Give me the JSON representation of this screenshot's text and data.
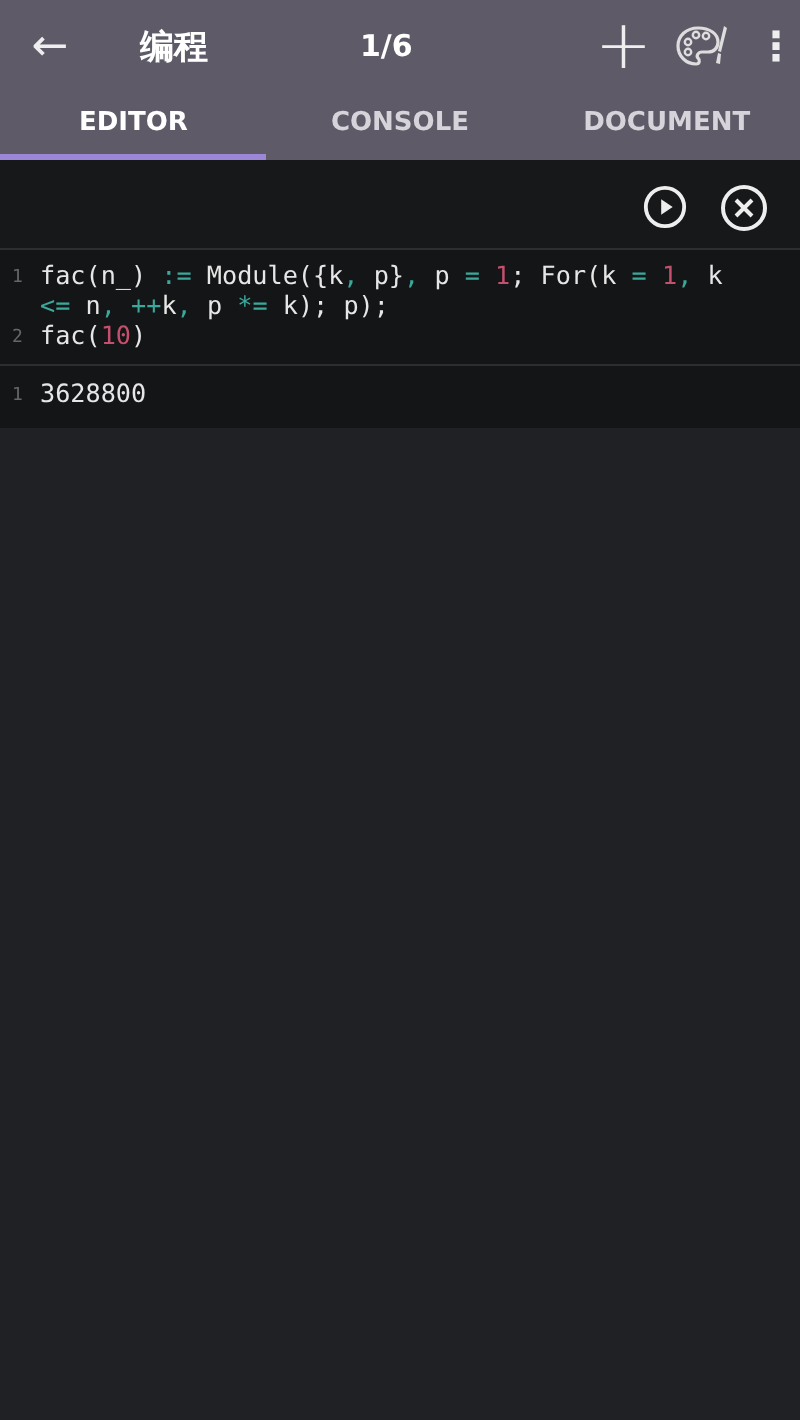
{
  "app_bar": {
    "back": "←",
    "title": "编程",
    "page": "1/6",
    "add": "+",
    "menu": "⋮"
  },
  "tabs": [
    {
      "label": "EDITOR",
      "selected": true
    },
    {
      "label": "CONSOLE",
      "selected": false
    },
    {
      "label": "DOCUMENT",
      "selected": false
    }
  ],
  "input_cell": {
    "lines": [
      {
        "number": "1",
        "tokens": [
          {
            "kind": "plain",
            "text": "fac(n_) "
          },
          {
            "kind": "op",
            "text": ":="
          },
          {
            "kind": "plain",
            "text": " Module({k"
          },
          {
            "kind": "op",
            "text": ","
          },
          {
            "kind": "plain",
            "text": " p}"
          },
          {
            "kind": "op",
            "text": ","
          },
          {
            "kind": "plain",
            "text": " p "
          },
          {
            "kind": "op",
            "text": "="
          },
          {
            "kind": "num",
            "text": " 1"
          },
          {
            "kind": "plain",
            "text": "; For(k "
          },
          {
            "kind": "op",
            "text": "="
          },
          {
            "kind": "num",
            "text": " 1"
          },
          {
            "kind": "op",
            "text": ","
          },
          {
            "kind": "plain",
            "text": " k "
          },
          {
            "kind": "op",
            "text": "<="
          },
          {
            "kind": "plain",
            "text": " n"
          },
          {
            "kind": "op",
            "text": ", ++"
          },
          {
            "kind": "plain",
            "text": "k"
          },
          {
            "kind": "op",
            "text": ","
          },
          {
            "kind": "plain",
            "text": " p "
          },
          {
            "kind": "op",
            "text": "*="
          },
          {
            "kind": "plain",
            "text": " k); p);"
          }
        ]
      },
      {
        "number": "2",
        "tokens": [
          {
            "kind": "plain",
            "text": "fac("
          },
          {
            "kind": "num",
            "text": "10"
          },
          {
            "kind": "plain",
            "text": ")"
          }
        ]
      }
    ]
  },
  "output_cell": {
    "lines": [
      {
        "number": "1",
        "text": "3628800"
      }
    ]
  }
}
